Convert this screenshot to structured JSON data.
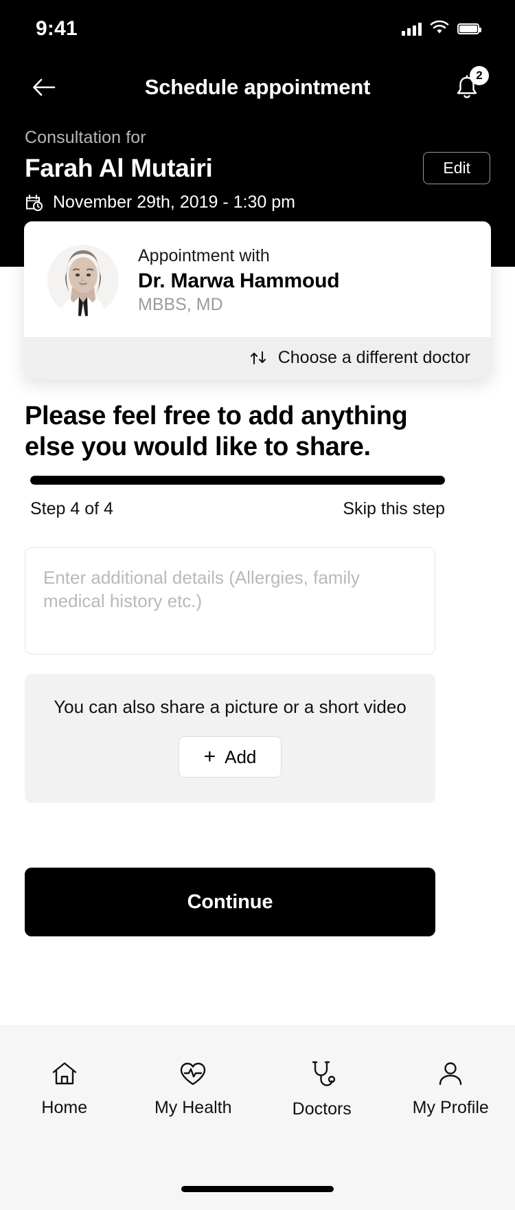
{
  "status_bar": {
    "time": "9:41",
    "cellular_icon": "signal-bars-icon",
    "wifi_icon": "wifi-icon",
    "battery_icon": "battery-icon"
  },
  "header": {
    "back_icon": "arrow-left-icon",
    "title": "Schedule appointment",
    "bell_icon": "bell-icon",
    "notification_count": "2"
  },
  "consultation": {
    "label": "Consultation for",
    "patient_name": "Farah Al Mutairi",
    "edit_label": "Edit",
    "calendar_icon": "calendar-clock-icon",
    "datetime": "November 29th, 2019 - 1:30 pm"
  },
  "doctor_card": {
    "avatar_icon": "doctor-avatar-photo",
    "appointment_with_label": "Appointment with",
    "doctor_name": "Dr. Marwa Hammoud",
    "credentials": "MBBS, MD",
    "swap_icon": "swap-arrows-icon",
    "change_doctor_label": "Choose a different doctor"
  },
  "main": {
    "headline": "Please feel free to add anything else you would like to share."
  },
  "progress": {
    "percent": 100,
    "step_label": "Step 4 of 4",
    "skip_label": "Skip this step"
  },
  "notes": {
    "placeholder": "Enter additional details (Allergies, family medical history etc.)",
    "value": ""
  },
  "media": {
    "prompt": "You can also share a picture or a short video",
    "add_icon": "plus-icon",
    "add_label": "Add"
  },
  "primary_action": {
    "continue_label": "Continue"
  },
  "bottom_nav": {
    "items": [
      {
        "icon": "home-icon",
        "label": "Home"
      },
      {
        "icon": "heart-pulse-icon",
        "label": "My Health"
      },
      {
        "icon": "stethoscope-icon",
        "label": "Doctors"
      },
      {
        "icon": "person-icon",
        "label": "My Profile"
      }
    ]
  },
  "colors": {
    "background": "#ffffff",
    "header_background": "#000000",
    "accent": "#000000",
    "muted_text": "#9b9b9b",
    "panel": "#f2f2f2",
    "nav_background": "#f6f6f6"
  }
}
